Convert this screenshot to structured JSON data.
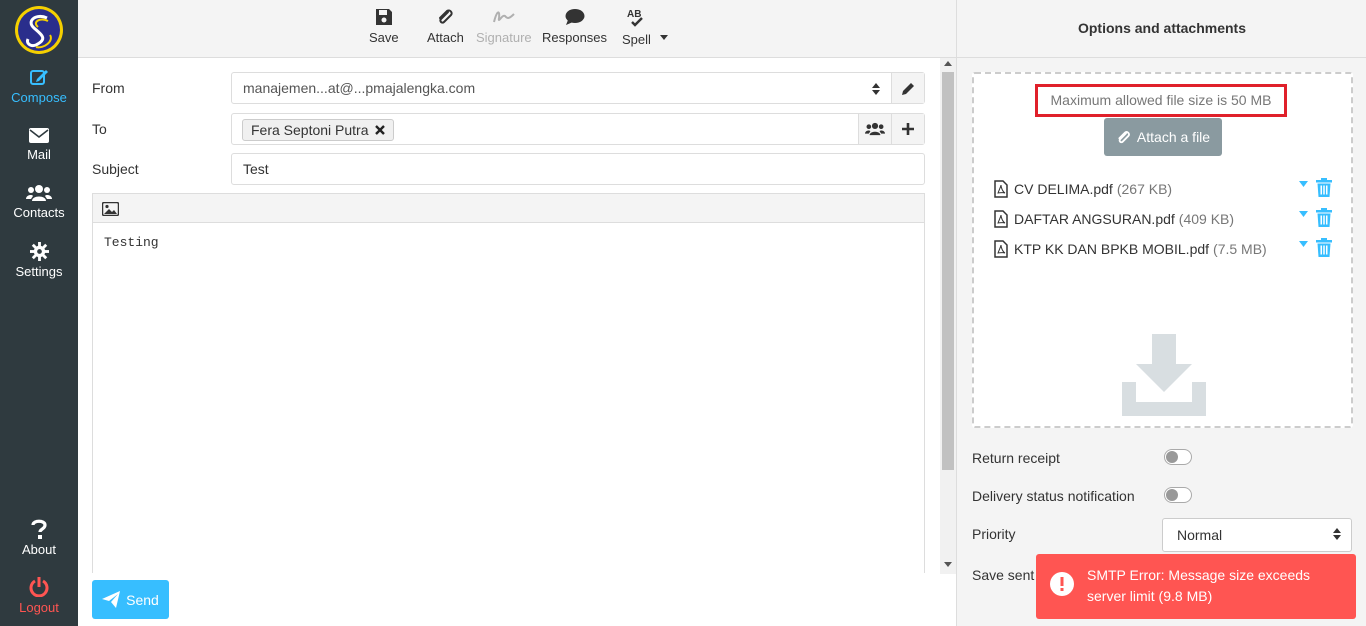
{
  "sidebar": {
    "items": [
      {
        "label": "Compose",
        "icon": "compose-icon"
      },
      {
        "label": "Mail",
        "icon": "envelope-icon"
      },
      {
        "label": "Contacts",
        "icon": "users-icon"
      },
      {
        "label": "Settings",
        "icon": "gear-icon"
      },
      {
        "label": "About",
        "icon": "question-icon"
      },
      {
        "label": "Logout",
        "icon": "power-icon"
      }
    ]
  },
  "toolbar": {
    "save": "Save",
    "attach": "Attach",
    "signature": "Signature",
    "responses": "Responses",
    "spell": "Spell"
  },
  "compose": {
    "from_label": "From",
    "from_value": "manajemen...at@...pmajalengka.com",
    "to_label": "To",
    "to_recipient": "Fera Septoni Putra",
    "subject_label": "Subject",
    "subject_value": "Test",
    "body": "Testing",
    "send_label": "Send"
  },
  "options": {
    "title": "Options and attachments",
    "max_size": "Maximum allowed file size is 50 MB",
    "attach_file": "Attach a file",
    "attachments": [
      {
        "name": "CV DELIMA.pdf",
        "size": "(267 KB)"
      },
      {
        "name": "DAFTAR ANGSURAN.pdf",
        "size": "(409 KB)"
      },
      {
        "name": "KTP KK DAN BPKB MOBIL.pdf",
        "size": "(7.5 MB)"
      }
    ],
    "return_receipt": "Return receipt",
    "delivery_status": "Delivery status notification",
    "priority_label": "Priority",
    "priority_value": "Normal",
    "save_sent": "Save sent"
  },
  "error": {
    "message": "SMTP Error: Message size exceeds server limit (9.8 MB)"
  },
  "colors": {
    "sidebar_bg": "#2f3a3f",
    "accent": "#37beff",
    "error": "#ff5552",
    "highlight_border": "#e0202a"
  }
}
